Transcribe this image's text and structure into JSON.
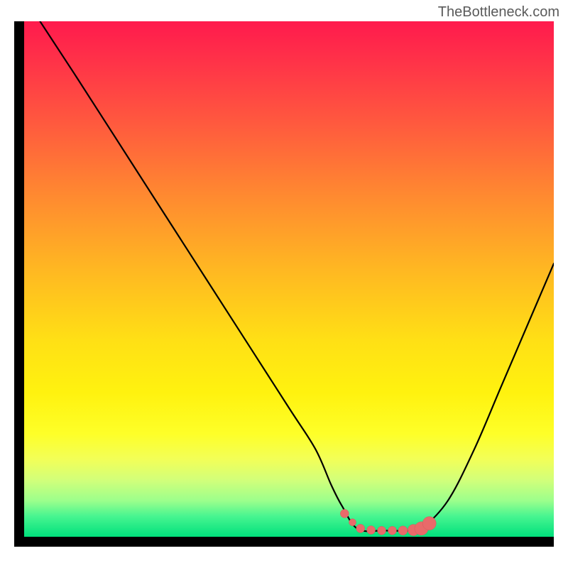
{
  "watermark": "TheBottleneck.com",
  "colors": {
    "frame": "#000000",
    "curve_stroke": "#000000",
    "marker_fill": "#e96a6a",
    "marker_stroke": "#d45a5a",
    "gradient_top": "#ff1a4d",
    "gradient_bottom": "#00e07c"
  },
  "chart_data": {
    "type": "line",
    "title": "",
    "xlabel": "",
    "ylabel": "",
    "xlim": [
      0,
      100
    ],
    "ylim": [
      0,
      100
    ],
    "grid": false,
    "curve": {
      "name": "bottleneck-curve",
      "x": [
        3,
        10,
        20,
        30,
        40,
        50,
        55,
        58,
        60,
        63,
        68,
        73,
        75,
        80,
        85,
        90,
        95,
        100
      ],
      "y": [
        100,
        89,
        73,
        57,
        41,
        25,
        17,
        10,
        6,
        1.5,
        1.2,
        1.2,
        1.5,
        7,
        17,
        29,
        41,
        53
      ]
    },
    "markers": {
      "name": "optimal-range",
      "points": [
        {
          "x": 60.5,
          "y": 4.5,
          "r": 1.2
        },
        {
          "x": 62,
          "y": 2.8,
          "r": 1.0
        },
        {
          "x": 63.5,
          "y": 1.6,
          "r": 1.2
        },
        {
          "x": 65.5,
          "y": 1.3,
          "r": 1.2
        },
        {
          "x": 67.5,
          "y": 1.2,
          "r": 1.2
        },
        {
          "x": 69.5,
          "y": 1.2,
          "r": 1.2
        },
        {
          "x": 71.5,
          "y": 1.2,
          "r": 1.3
        },
        {
          "x": 73.5,
          "y": 1.3,
          "r": 1.6
        },
        {
          "x": 75,
          "y": 1.6,
          "r": 1.9
        },
        {
          "x": 76.5,
          "y": 2.6,
          "r": 1.9
        }
      ]
    }
  }
}
